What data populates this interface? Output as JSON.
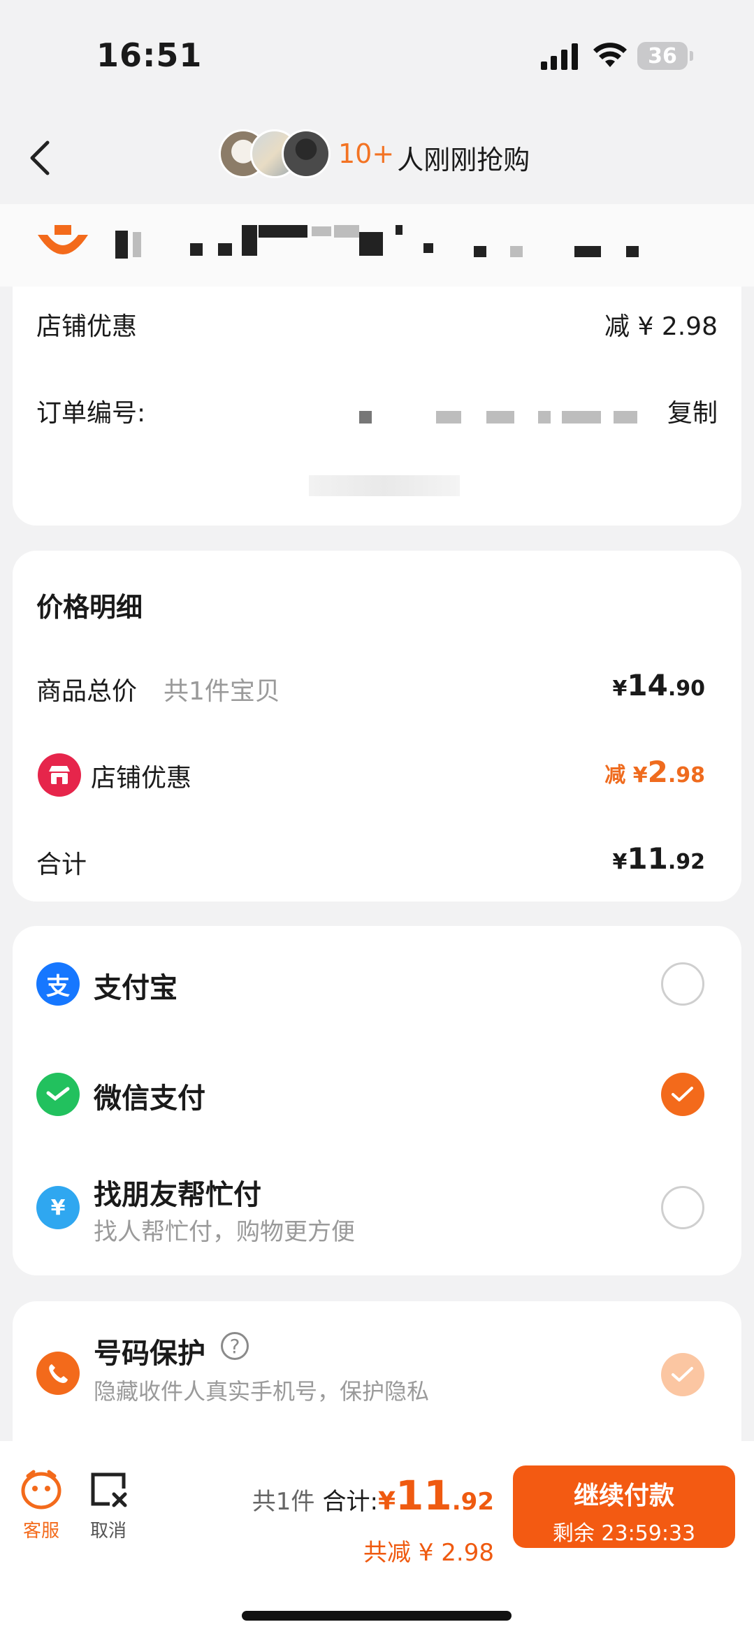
{
  "status_bar": {
    "time": "16:51",
    "battery": "36"
  },
  "header": {
    "count": "10+",
    "text": "人刚刚抢购"
  },
  "order_card": {
    "discount_label": "店铺优惠",
    "discount_value": "减 ¥ 2.98",
    "order_no_label": "订单编号:",
    "copy_label": "复制"
  },
  "price_detail": {
    "title": "价格明细",
    "subtotal_label": "商品总价",
    "subtotal_note": "共1件宝贝",
    "subtotal": {
      "yen": "¥",
      "int": "14",
      "dec": ".90"
    },
    "shop_discount_label": "店铺优惠",
    "shop_discount": {
      "prefix": "减 ¥",
      "int": "2",
      "dec": ".98"
    },
    "total_label": "合计",
    "total": {
      "yen": "¥",
      "int": "11",
      "dec": ".92"
    }
  },
  "payment": {
    "methods": [
      {
        "label": "支付宝",
        "selected": false,
        "icon": "alipay-icon"
      },
      {
        "label": "微信支付",
        "selected": true,
        "icon": "wechat-pay-icon"
      },
      {
        "label": "找朋友帮忙付",
        "sub": "找人帮忙付，购物更方便",
        "selected": false,
        "icon": "friend-pay-icon"
      }
    ]
  },
  "number_protection": {
    "title": "号码保护",
    "sub": "隐藏收件人真实手机号，保护隐私",
    "icon": "phone-shield-icon",
    "help_icon": "help-icon",
    "checked": true
  },
  "bottom_bar": {
    "service_label": "客服",
    "cancel_label": "取消",
    "count_label": "共1件",
    "total_label": "合计:",
    "total_yen": "¥",
    "total_int": "11",
    "total_dec": ".92",
    "saved_label": "共减 ¥ 2.98",
    "pay_button": "继续付款",
    "remaining": "剩余 23:59:33"
  },
  "colors": {
    "accent": "#f35a12",
    "orange_text": "#ef6b1e",
    "alipay": "#1677ff",
    "wechat": "#22c15e"
  }
}
